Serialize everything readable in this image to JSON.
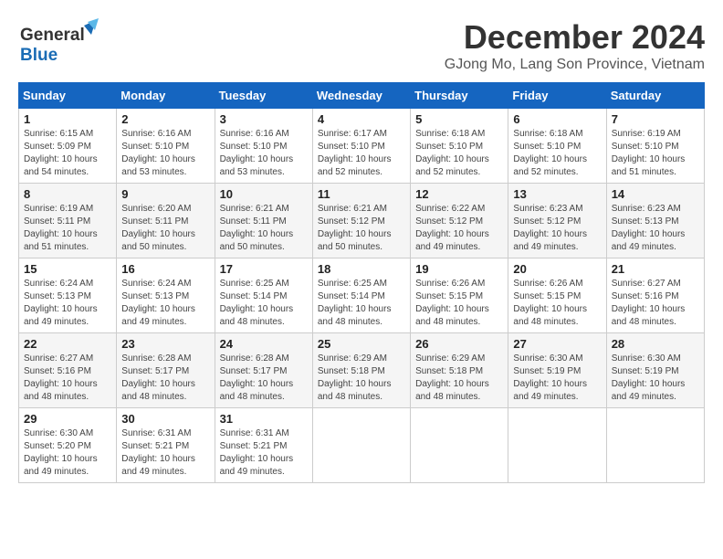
{
  "header": {
    "logo_line1": "General",
    "logo_line2": "Blue",
    "month_title": "December 2024",
    "location": "GJong Mo, Lang Son Province, Vietnam"
  },
  "calendar": {
    "days_of_week": [
      "Sunday",
      "Monday",
      "Tuesday",
      "Wednesday",
      "Thursday",
      "Friday",
      "Saturday"
    ],
    "weeks": [
      [
        null,
        null,
        null,
        null,
        null,
        null,
        null
      ]
    ],
    "cells": [
      {
        "day": null,
        "info": ""
      },
      {
        "day": null,
        "info": ""
      },
      {
        "day": null,
        "info": ""
      },
      {
        "day": null,
        "info": ""
      },
      {
        "day": null,
        "info": ""
      },
      {
        "day": null,
        "info": ""
      },
      {
        "day": null,
        "info": ""
      }
    ]
  },
  "days": [
    {
      "num": "1",
      "sunrise": "6:15 AM",
      "sunset": "5:09 PM",
      "daylight": "10 hours and 54 minutes."
    },
    {
      "num": "2",
      "sunrise": "6:16 AM",
      "sunset": "5:10 PM",
      "daylight": "10 hours and 53 minutes."
    },
    {
      "num": "3",
      "sunrise": "6:16 AM",
      "sunset": "5:10 PM",
      "daylight": "10 hours and 53 minutes."
    },
    {
      "num": "4",
      "sunrise": "6:17 AM",
      "sunset": "5:10 PM",
      "daylight": "10 hours and 52 minutes."
    },
    {
      "num": "5",
      "sunrise": "6:18 AM",
      "sunset": "5:10 PM",
      "daylight": "10 hours and 52 minutes."
    },
    {
      "num": "6",
      "sunrise": "6:18 AM",
      "sunset": "5:10 PM",
      "daylight": "10 hours and 52 minutes."
    },
    {
      "num": "7",
      "sunrise": "6:19 AM",
      "sunset": "5:10 PM",
      "daylight": "10 hours and 51 minutes."
    },
    {
      "num": "8",
      "sunrise": "6:19 AM",
      "sunset": "5:11 PM",
      "daylight": "10 hours and 51 minutes."
    },
    {
      "num": "9",
      "sunrise": "6:20 AM",
      "sunset": "5:11 PM",
      "daylight": "10 hours and 50 minutes."
    },
    {
      "num": "10",
      "sunrise": "6:21 AM",
      "sunset": "5:11 PM",
      "daylight": "10 hours and 50 minutes."
    },
    {
      "num": "11",
      "sunrise": "6:21 AM",
      "sunset": "5:12 PM",
      "daylight": "10 hours and 50 minutes."
    },
    {
      "num": "12",
      "sunrise": "6:22 AM",
      "sunset": "5:12 PM",
      "daylight": "10 hours and 49 minutes."
    },
    {
      "num": "13",
      "sunrise": "6:23 AM",
      "sunset": "5:12 PM",
      "daylight": "10 hours and 49 minutes."
    },
    {
      "num": "14",
      "sunrise": "6:23 AM",
      "sunset": "5:13 PM",
      "daylight": "10 hours and 49 minutes."
    },
    {
      "num": "15",
      "sunrise": "6:24 AM",
      "sunset": "5:13 PM",
      "daylight": "10 hours and 49 minutes."
    },
    {
      "num": "16",
      "sunrise": "6:24 AM",
      "sunset": "5:13 PM",
      "daylight": "10 hours and 49 minutes."
    },
    {
      "num": "17",
      "sunrise": "6:25 AM",
      "sunset": "5:14 PM",
      "daylight": "10 hours and 48 minutes."
    },
    {
      "num": "18",
      "sunrise": "6:25 AM",
      "sunset": "5:14 PM",
      "daylight": "10 hours and 48 minutes."
    },
    {
      "num": "19",
      "sunrise": "6:26 AM",
      "sunset": "5:15 PM",
      "daylight": "10 hours and 48 minutes."
    },
    {
      "num": "20",
      "sunrise": "6:26 AM",
      "sunset": "5:15 PM",
      "daylight": "10 hours and 48 minutes."
    },
    {
      "num": "21",
      "sunrise": "6:27 AM",
      "sunset": "5:16 PM",
      "daylight": "10 hours and 48 minutes."
    },
    {
      "num": "22",
      "sunrise": "6:27 AM",
      "sunset": "5:16 PM",
      "daylight": "10 hours and 48 minutes."
    },
    {
      "num": "23",
      "sunrise": "6:28 AM",
      "sunset": "5:17 PM",
      "daylight": "10 hours and 48 minutes."
    },
    {
      "num": "24",
      "sunrise": "6:28 AM",
      "sunset": "5:17 PM",
      "daylight": "10 hours and 48 minutes."
    },
    {
      "num": "25",
      "sunrise": "6:29 AM",
      "sunset": "5:18 PM",
      "daylight": "10 hours and 48 minutes."
    },
    {
      "num": "26",
      "sunrise": "6:29 AM",
      "sunset": "5:18 PM",
      "daylight": "10 hours and 48 minutes."
    },
    {
      "num": "27",
      "sunrise": "6:30 AM",
      "sunset": "5:19 PM",
      "daylight": "10 hours and 49 minutes."
    },
    {
      "num": "28",
      "sunrise": "6:30 AM",
      "sunset": "5:19 PM",
      "daylight": "10 hours and 49 minutes."
    },
    {
      "num": "29",
      "sunrise": "6:30 AM",
      "sunset": "5:20 PM",
      "daylight": "10 hours and 49 minutes."
    },
    {
      "num": "30",
      "sunrise": "6:31 AM",
      "sunset": "5:21 PM",
      "daylight": "10 hours and 49 minutes."
    },
    {
      "num": "31",
      "sunrise": "6:31 AM",
      "sunset": "5:21 PM",
      "daylight": "10 hours and 49 minutes."
    }
  ]
}
